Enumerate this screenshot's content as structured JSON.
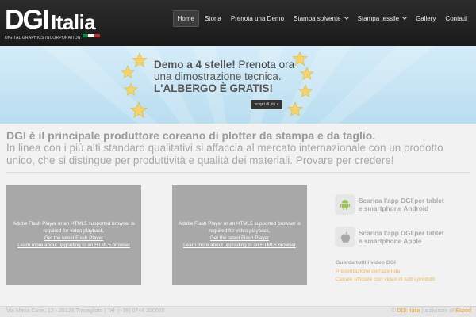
{
  "logo": {
    "brand": "DGI",
    "country": "Italia",
    "tagline": "DIGITAL GRAPHICS INCORPORATION",
    "flag_colors": [
      "#009246",
      "#ffffff",
      "#ce2b37"
    ]
  },
  "nav": {
    "items": [
      {
        "label": "Home",
        "active": true
      },
      {
        "label": "Storia"
      },
      {
        "label": "Prenota una Demo"
      },
      {
        "label": "Stampa solvente",
        "dropdown": true
      },
      {
        "label": "Stampa tessile",
        "dropdown": true
      },
      {
        "label": "Gallery"
      },
      {
        "label": "Contatti"
      }
    ]
  },
  "banner": {
    "line1": "Demo a 4 stelle!",
    "line1b": " Prenota ora",
    "line2": "una dimostrazione tecnica.",
    "line3": "L'ALBERGO È GRATIS!",
    "button": "scopri di più »",
    "star_color": "#f4d46a"
  },
  "intro": {
    "title": "DGI è il principale produttore coreano di plotter da stampa e da taglio.",
    "text": "In linea con i più alti standard qualitativi si affaccia al mercato internazionale con un prodotto unico, che si distingue per produttività e qualità dei materiali. Provare per credere!"
  },
  "videos": [
    {
      "message": "Adobe Flash Player or an HTML5 supported browser is required for video playback.",
      "link1": "Get the latest Flash Player",
      "link2": "Learn more about upgrading to an HTML5 browser"
    },
    {
      "message": "Adobe Flash Player or an HTML5 supported browser is required for video playback.",
      "link1": "Get the latest Flash Player",
      "link2": "Learn more about upgrading to an HTML5 browser"
    }
  ],
  "apps": {
    "android": {
      "line1": "Scarica l'app DGI per tablet",
      "line2": "e smartphone Android",
      "icon": "android-icon"
    },
    "apple": {
      "line1": "Scarica l'app DGI per tablet",
      "line2": "e smartphone Apple",
      "icon": "apple-icon"
    }
  },
  "links": {
    "all_videos": "Guarda tutti i video DGI",
    "presentation": "Presentazione dell'azienda",
    "channel": "Canale ufficiale con video di tutti i prodotti"
  },
  "footer": {
    "left": "Via Maria Curie, 12 - 25126 Travagliato | Tel: (+39) 0744 200000",
    "right_prefix": "© ",
    "right_brand": "DGI Italia",
    "right_mid": " | a division of ",
    "right_link": "Espod"
  },
  "colors": {
    "accent": "#f0a030",
    "header_bg": "#222222",
    "banner_bg": "#c6e4f4"
  }
}
